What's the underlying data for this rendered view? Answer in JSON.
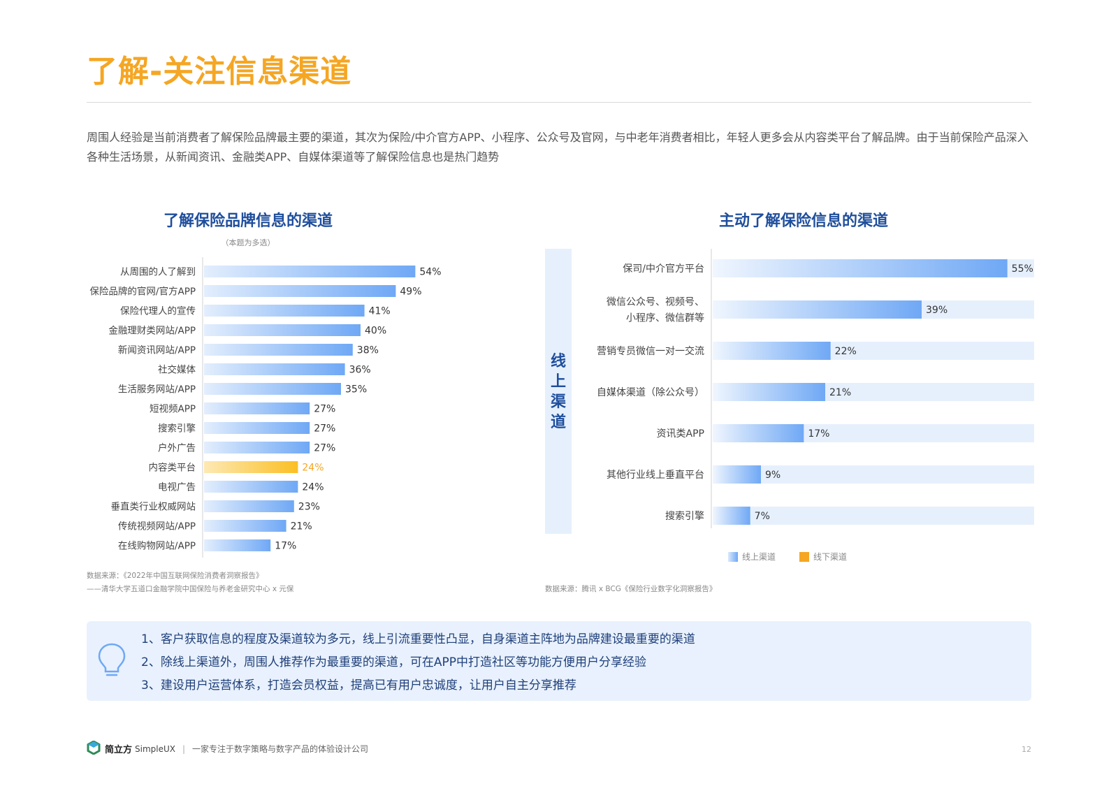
{
  "page": {
    "title": "了解-关注信息渠道",
    "intro": "周围人经验是当前消费者了解保险品牌最主要的渠道，其次为保险/中介官方APP、小程序、公众号及官网，与中老年消费者相比，年轻人更多会从内容类平台了解品牌。由于当前保险产品深入各种生活场景，从新闻资讯、金融类APP、自媒体渠道等了解保险信息也是热门趋势",
    "page_number": "12"
  },
  "colors": {
    "title": "#f5a623",
    "bar_blue": "#6fa8f5",
    "bar_highlight": "#fbbf24",
    "bar_track": "#e6f0fd",
    "heading_blue": "#1f4e9c"
  },
  "chart_data": [
    {
      "type": "bar",
      "orientation": "horizontal",
      "title": "了解保险品牌信息的渠道",
      "subtitle": "（本题为多选）",
      "categories": [
        "从周围的人了解到",
        "保险品牌的官网/官方APP",
        "保险代理人的宣传",
        "金融理财类网站/APP",
        "新闻资讯网站/APP",
        "社交媒体",
        "生活服务网站/APP",
        "短视频APP",
        "搜索引擎",
        "户外广告",
        "内容类平台",
        "电视广告",
        "垂直类行业权威网站",
        "传统视频网站/APP",
        "在线购物网站/APP"
      ],
      "values": [
        54,
        49,
        41,
        40,
        38,
        36,
        35,
        27,
        27,
        27,
        24,
        24,
        23,
        21,
        17
      ],
      "value_labels": [
        "54%",
        "49%",
        "41%",
        "40%",
        "38%",
        "36%",
        "35%",
        "27%",
        "27%",
        "27%",
        "24%",
        "24%",
        "23%",
        "21%",
        "17%"
      ],
      "highlight_category": "内容类平台",
      "xlim": [
        0,
        100
      ],
      "source_lines": [
        "数据来源：《2022年中国互联网保险消费者洞察报告》",
        "——清华大学五道口金融学院中国保险与养老金研究中心 x 元保"
      ]
    },
    {
      "type": "bar",
      "orientation": "horizontal",
      "title": "主动了解保险信息的渠道",
      "group_label": "线上渠道",
      "categories": [
        [
          "保司/中介官方平台"
        ],
        [
          "微信公众号、视频号、",
          "小程序、微信群等"
        ],
        [
          "营销专员微信一对一交流"
        ],
        [
          "自媒体渠道（除公众号）"
        ],
        [
          "资讯类APP"
        ],
        [
          "其他行业线上垂直平台"
        ],
        [
          "搜索引擎"
        ]
      ],
      "values": [
        55,
        39,
        22,
        21,
        17,
        9,
        7
      ],
      "value_labels": [
        "55%",
        "39%",
        "22%",
        "21%",
        "17%",
        "9%",
        "7%"
      ],
      "xlim": [
        0,
        60
      ],
      "legend": [
        "线上渠道",
        "线下渠道"
      ],
      "legend_colors": [
        "#6fa8f5",
        "#f5a623"
      ],
      "source_lines": [
        "数据来源：腾讯 x BCG《保险行业数字化洞察报告》"
      ]
    }
  ],
  "conclusions": [
    "1、客户获取信息的程度及渠道较为多元，线上引流重要性凸显，自身渠道主阵地为品牌建设最重要的渠道",
    "2、除线上渠道外，周围人推荐作为最重要的渠道，可在APP中打造社区等功能方便用户分享经验",
    "3、建设用户运营体系，打造会员权益，提高已有用户忠诚度，让用户自主分享推荐"
  ],
  "footer": {
    "brand_cn": "简立方",
    "brand_en": "SimpleUX",
    "separator": "|",
    "tagline": "一家专注于数字策略与数字产品的体验设计公司"
  }
}
